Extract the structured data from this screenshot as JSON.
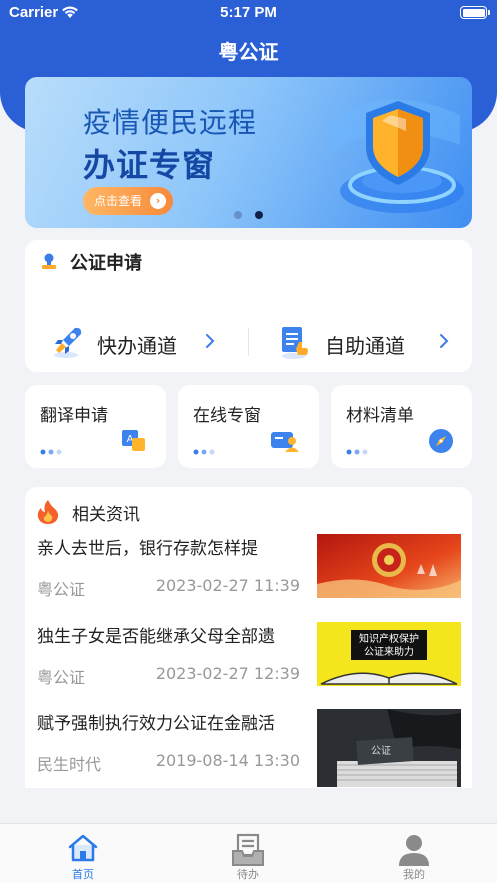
{
  "status_bar": {
    "carrier": "Carrier",
    "time": "5:17 PM"
  },
  "header": {
    "title": "粤公证"
  },
  "banner": {
    "line1": "疫情便民远程",
    "line2": "办证专窗",
    "button": "点击查看",
    "page_count": 2,
    "active_page": 2
  },
  "apply": {
    "title": "公证申请",
    "channels": [
      {
        "label": "快办通道",
        "icon": "rocket-icon"
      },
      {
        "label": "自助通道",
        "icon": "document-hand-icon"
      }
    ]
  },
  "shortcuts": [
    {
      "label": "翻译申请",
      "icon": "translate-icon"
    },
    {
      "label": "在线专窗",
      "icon": "video-chat-icon"
    },
    {
      "label": "材料清单",
      "icon": "compass-icon"
    }
  ],
  "news": {
    "title": "相关资讯",
    "items": [
      {
        "title": "亲人去世后，银行存款怎样提",
        "source": "粤公证",
        "time": "2023-02-27 11:39"
      },
      {
        "title": "独生子女是否能继承父母全部遗",
        "source": "粤公证",
        "time": "2023-02-27 12:39",
        "thumb_text_1": "知识产权保护",
        "thumb_text_2": "公证来助力"
      },
      {
        "title": "赋予强制执行效力公证在金融活",
        "source": "民生时代",
        "time": "2019-08-14 13:30",
        "thumb_text": "公证"
      }
    ]
  },
  "tabbar": {
    "tabs": [
      {
        "label": "首页",
        "icon": "home-icon",
        "active": true
      },
      {
        "label": "待办",
        "icon": "inbox-icon",
        "active": false
      },
      {
        "label": "我的",
        "icon": "user-icon",
        "active": false
      }
    ]
  },
  "colors": {
    "primary": "#2b5fd6",
    "accent": "#2b7ae8",
    "button_orange": "#f68a3a"
  }
}
